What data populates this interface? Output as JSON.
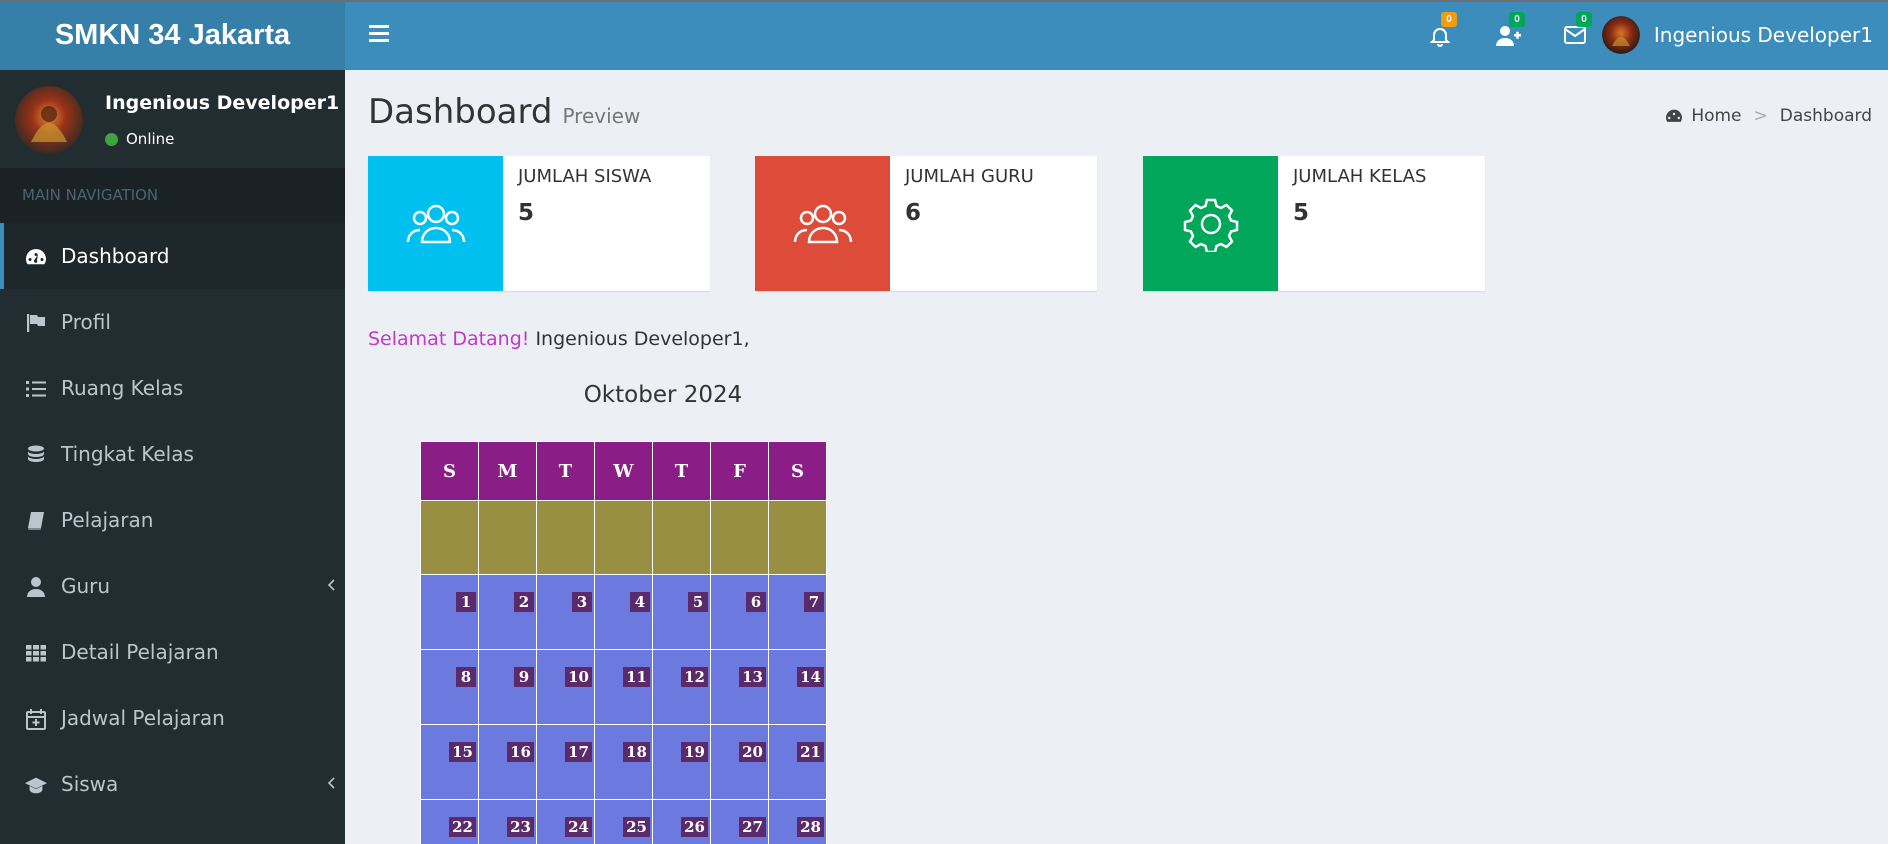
{
  "app": {
    "brand": "SMKN 34 Jakarta",
    "user_name": "Ingenious Developer1"
  },
  "navbar": {
    "notifications_count": "0",
    "friend_requests_count": "0",
    "messages_count": "0",
    "colors": {
      "notifications_badge": "#f39c12",
      "friends_badge": "#00a65a",
      "messages_badge": "#00a65a"
    }
  },
  "sidebar": {
    "user_name": "Ingenious Developer1",
    "status": "Online",
    "header": "MAIN NAVIGATION",
    "items": [
      {
        "label": "Dashboard",
        "icon": "dashboard-icon",
        "active": true
      },
      {
        "label": "Profil",
        "icon": "flag-icon"
      },
      {
        "label": "Ruang Kelas",
        "icon": "list-icon"
      },
      {
        "label": "Tingkat Kelas",
        "icon": "database-icon"
      },
      {
        "label": "Pelajaran",
        "icon": "book-icon"
      },
      {
        "label": "Guru",
        "icon": "user-icon",
        "has_submenu": true
      },
      {
        "label": "Detail Pelajaran",
        "icon": "grid-icon"
      },
      {
        "label": "Jadwal Pelajaran",
        "icon": "calendar-plus-icon"
      },
      {
        "label": "Siswa",
        "icon": "graduation-cap-icon",
        "has_submenu": true
      }
    ]
  },
  "page": {
    "title": "Dashboard",
    "subtitle": "Preview",
    "breadcrumb": {
      "home": "Home",
      "current": "Dashboard"
    }
  },
  "info_boxes": [
    {
      "label": "JUMLAH SISWA",
      "value": "5",
      "color": "#00c0ef",
      "icon": "users-icon"
    },
    {
      "label": "JUMLAH GURU",
      "value": "6",
      "color": "#dd4b39",
      "icon": "users-icon"
    },
    {
      "label": "JUMLAH KELAS",
      "value": "5",
      "color": "#00a65a",
      "icon": "gear-icon"
    }
  ],
  "welcome": {
    "greeting": "Selamat Datang!",
    "name": "Ingenious Developer1,"
  },
  "calendar": {
    "title": "Oktober 2024",
    "days": [
      "S",
      "M",
      "T",
      "W",
      "T",
      "F",
      "S"
    ],
    "weeks": [
      [
        "1",
        "2",
        "3",
        "4",
        "5",
        "6",
        "7"
      ],
      [
        "8",
        "9",
        "10",
        "11",
        "12",
        "13",
        "14"
      ],
      [
        "15",
        "16",
        "17",
        "18",
        "19",
        "20",
        "21"
      ],
      [
        "22",
        "23",
        "24",
        "25",
        "26",
        "27",
        "28"
      ]
    ],
    "today": "25"
  }
}
